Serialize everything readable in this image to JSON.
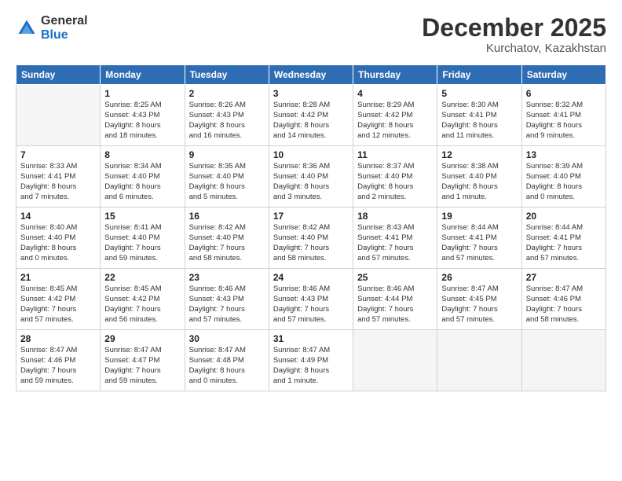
{
  "logo": {
    "general": "General",
    "blue": "Blue"
  },
  "header": {
    "month": "December 2025",
    "location": "Kurchatov, Kazakhstan"
  },
  "days_of_week": [
    "Sunday",
    "Monday",
    "Tuesday",
    "Wednesday",
    "Thursday",
    "Friday",
    "Saturday"
  ],
  "weeks": [
    [
      {
        "day": "",
        "info": ""
      },
      {
        "day": "1",
        "info": "Sunrise: 8:25 AM\nSunset: 4:43 PM\nDaylight: 8 hours\nand 18 minutes."
      },
      {
        "day": "2",
        "info": "Sunrise: 8:26 AM\nSunset: 4:43 PM\nDaylight: 8 hours\nand 16 minutes."
      },
      {
        "day": "3",
        "info": "Sunrise: 8:28 AM\nSunset: 4:42 PM\nDaylight: 8 hours\nand 14 minutes."
      },
      {
        "day": "4",
        "info": "Sunrise: 8:29 AM\nSunset: 4:42 PM\nDaylight: 8 hours\nand 12 minutes."
      },
      {
        "day": "5",
        "info": "Sunrise: 8:30 AM\nSunset: 4:41 PM\nDaylight: 8 hours\nand 11 minutes."
      },
      {
        "day": "6",
        "info": "Sunrise: 8:32 AM\nSunset: 4:41 PM\nDaylight: 8 hours\nand 9 minutes."
      }
    ],
    [
      {
        "day": "7",
        "info": "Sunrise: 8:33 AM\nSunset: 4:41 PM\nDaylight: 8 hours\nand 7 minutes."
      },
      {
        "day": "8",
        "info": "Sunrise: 8:34 AM\nSunset: 4:40 PM\nDaylight: 8 hours\nand 6 minutes."
      },
      {
        "day": "9",
        "info": "Sunrise: 8:35 AM\nSunset: 4:40 PM\nDaylight: 8 hours\nand 5 minutes."
      },
      {
        "day": "10",
        "info": "Sunrise: 8:36 AM\nSunset: 4:40 PM\nDaylight: 8 hours\nand 3 minutes."
      },
      {
        "day": "11",
        "info": "Sunrise: 8:37 AM\nSunset: 4:40 PM\nDaylight: 8 hours\nand 2 minutes."
      },
      {
        "day": "12",
        "info": "Sunrise: 8:38 AM\nSunset: 4:40 PM\nDaylight: 8 hours\nand 1 minute."
      },
      {
        "day": "13",
        "info": "Sunrise: 8:39 AM\nSunset: 4:40 PM\nDaylight: 8 hours\nand 0 minutes."
      }
    ],
    [
      {
        "day": "14",
        "info": "Sunrise: 8:40 AM\nSunset: 4:40 PM\nDaylight: 8 hours\nand 0 minutes."
      },
      {
        "day": "15",
        "info": "Sunrise: 8:41 AM\nSunset: 4:40 PM\nDaylight: 7 hours\nand 59 minutes."
      },
      {
        "day": "16",
        "info": "Sunrise: 8:42 AM\nSunset: 4:40 PM\nDaylight: 7 hours\nand 58 minutes."
      },
      {
        "day": "17",
        "info": "Sunrise: 8:42 AM\nSunset: 4:40 PM\nDaylight: 7 hours\nand 58 minutes."
      },
      {
        "day": "18",
        "info": "Sunrise: 8:43 AM\nSunset: 4:41 PM\nDaylight: 7 hours\nand 57 minutes."
      },
      {
        "day": "19",
        "info": "Sunrise: 8:44 AM\nSunset: 4:41 PM\nDaylight: 7 hours\nand 57 minutes."
      },
      {
        "day": "20",
        "info": "Sunrise: 8:44 AM\nSunset: 4:41 PM\nDaylight: 7 hours\nand 57 minutes."
      }
    ],
    [
      {
        "day": "21",
        "info": "Sunrise: 8:45 AM\nSunset: 4:42 PM\nDaylight: 7 hours\nand 57 minutes."
      },
      {
        "day": "22",
        "info": "Sunrise: 8:45 AM\nSunset: 4:42 PM\nDaylight: 7 hours\nand 56 minutes."
      },
      {
        "day": "23",
        "info": "Sunrise: 8:46 AM\nSunset: 4:43 PM\nDaylight: 7 hours\nand 57 minutes."
      },
      {
        "day": "24",
        "info": "Sunrise: 8:46 AM\nSunset: 4:43 PM\nDaylight: 7 hours\nand 57 minutes."
      },
      {
        "day": "25",
        "info": "Sunrise: 8:46 AM\nSunset: 4:44 PM\nDaylight: 7 hours\nand 57 minutes."
      },
      {
        "day": "26",
        "info": "Sunrise: 8:47 AM\nSunset: 4:45 PM\nDaylight: 7 hours\nand 57 minutes."
      },
      {
        "day": "27",
        "info": "Sunrise: 8:47 AM\nSunset: 4:46 PM\nDaylight: 7 hours\nand 58 minutes."
      }
    ],
    [
      {
        "day": "28",
        "info": "Sunrise: 8:47 AM\nSunset: 4:46 PM\nDaylight: 7 hours\nand 59 minutes."
      },
      {
        "day": "29",
        "info": "Sunrise: 8:47 AM\nSunset: 4:47 PM\nDaylight: 7 hours\nand 59 minutes."
      },
      {
        "day": "30",
        "info": "Sunrise: 8:47 AM\nSunset: 4:48 PM\nDaylight: 8 hours\nand 0 minutes."
      },
      {
        "day": "31",
        "info": "Sunrise: 8:47 AM\nSunset: 4:49 PM\nDaylight: 8 hours\nand 1 minute."
      },
      {
        "day": "",
        "info": ""
      },
      {
        "day": "",
        "info": ""
      },
      {
        "day": "",
        "info": ""
      }
    ]
  ]
}
